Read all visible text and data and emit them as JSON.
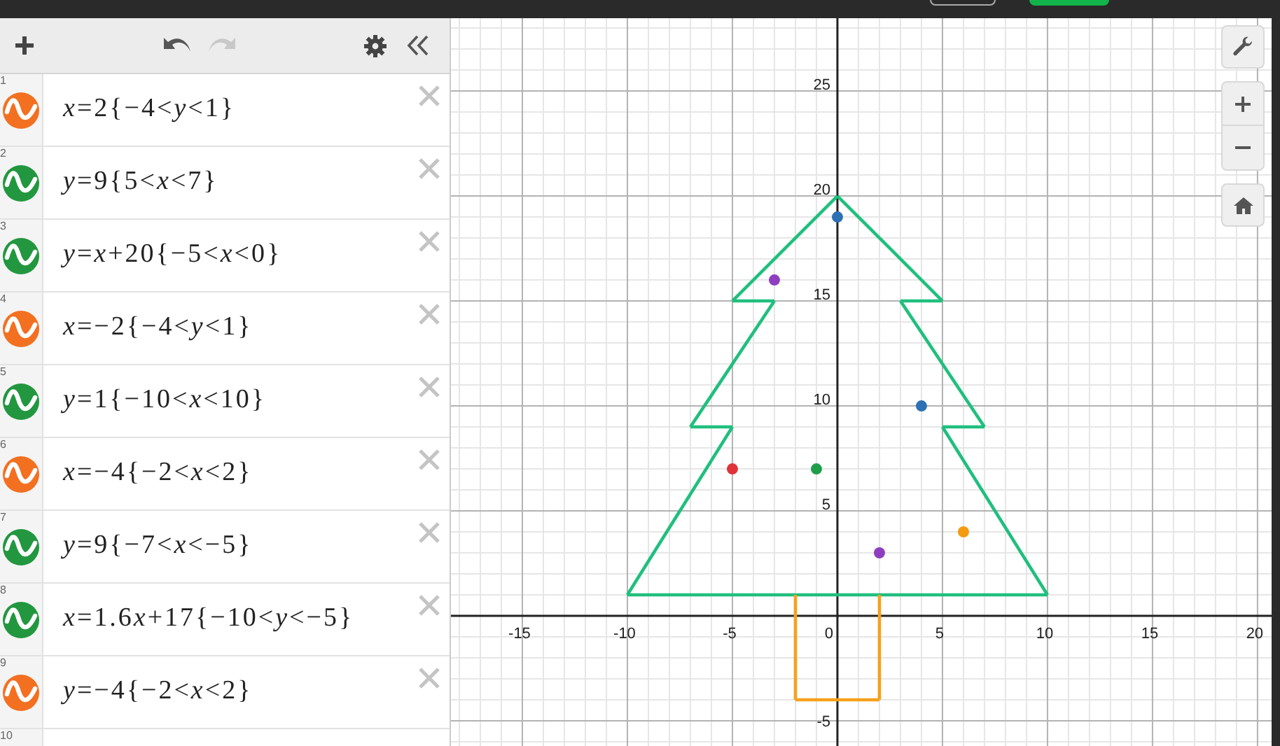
{
  "expressions": [
    {
      "number": "1",
      "color": "#f37021",
      "latex": [
        "*x*=2{−4<*y*<1}"
      ]
    },
    {
      "number": "2",
      "color": "#22973f",
      "latex": [
        "*y*=9{5<*x*<7}"
      ]
    },
    {
      "number": "3",
      "color": "#22973f",
      "latex": [
        "*y*=*x*+20{−5<*x*<0}"
      ]
    },
    {
      "number": "4",
      "color": "#f37021",
      "latex": [
        "*x*=−2{−4<*y*<1}"
      ]
    },
    {
      "number": "5",
      "color": "#22973f",
      "latex": [
        "*y*=1{−10<*x*<10}"
      ]
    },
    {
      "number": "6",
      "color": "#f37021",
      "latex": [
        "*x*=−4{−2<*x*<2}"
      ]
    },
    {
      "number": "7",
      "color": "#22973f",
      "latex": [
        "*y*=9{−7<*x*<−5}"
      ]
    },
    {
      "number": "8",
      "color": "#22973f",
      "latex": [
        "*x*=1.6",
        "*x*+17{−10<*y*<−5}"
      ]
    },
    {
      "number": "9",
      "color": "#f37021",
      "latex": [
        "*y*=−4{−2<*x*<2}"
      ]
    }
  ],
  "partial_row": {
    "number": "10"
  },
  "graph": {
    "chart_data": {
      "type": "line",
      "grid": true,
      "xlim": [
        -18.4,
        20.67
      ],
      "ylim": [
        -6.2,
        28.47
      ],
      "xticks": [
        -15,
        -10,
        -5,
        0,
        5,
        10,
        15,
        20
      ],
      "yticks": [
        -5,
        5,
        10,
        15,
        20,
        25
      ],
      "series": [
        {
          "type": "line",
          "color": "#20bf7e",
          "x": [
            -5,
            0
          ],
          "values": [
            15,
            20
          ]
        },
        {
          "type": "line",
          "color": "#20bf7e",
          "x": [
            -5,
            -3
          ],
          "values": [
            15,
            15
          ]
        },
        {
          "type": "line",
          "color": "#20bf7e",
          "x": [
            -7,
            -3
          ],
          "values": [
            9,
            15
          ]
        },
        {
          "type": "line",
          "color": "#20bf7e",
          "x": [
            -7,
            -5
          ],
          "values": [
            9,
            9
          ]
        },
        {
          "type": "line",
          "color": "#20bf7e",
          "x": [
            -10,
            -5
          ],
          "values": [
            1,
            9
          ]
        },
        {
          "type": "line",
          "color": "#20bf7e",
          "x": [
            -10,
            10
          ],
          "values": [
            1,
            1
          ]
        },
        {
          "type": "line",
          "color": "#20bf7e",
          "x": [
            5,
            10
          ],
          "values": [
            9,
            1
          ]
        },
        {
          "type": "line",
          "color": "#20bf7e",
          "x": [
            5,
            7
          ],
          "values": [
            9,
            9
          ]
        },
        {
          "type": "line",
          "color": "#20bf7e",
          "x": [
            3,
            7
          ],
          "values": [
            15,
            9
          ]
        },
        {
          "type": "line",
          "color": "#20bf7e",
          "x": [
            3,
            5
          ],
          "values": [
            15,
            15
          ]
        },
        {
          "type": "line",
          "color": "#20bf7e",
          "x": [
            0,
            5
          ],
          "values": [
            20,
            15
          ]
        },
        {
          "type": "line",
          "color": "#f5a11d",
          "x": [
            -2,
            -2
          ],
          "values": [
            1,
            -4
          ]
        },
        {
          "type": "line",
          "color": "#f5a11d",
          "x": [
            -2,
            2
          ],
          "values": [
            -4,
            -4
          ]
        },
        {
          "type": "line",
          "color": "#f5a11d",
          "x": [
            2,
            2
          ],
          "values": [
            -4,
            1
          ]
        },
        {
          "type": "scatter",
          "color": "#2d70b3",
          "x": [
            0,
            4
          ],
          "values": [
            19,
            10
          ]
        },
        {
          "type": "scatter",
          "color": "#8e3fbf",
          "x": [
            -3,
            2
          ],
          "values": [
            16,
            3
          ]
        },
        {
          "type": "scatter",
          "color": "#e0323a",
          "x": [
            -5
          ],
          "values": [
            7
          ]
        },
        {
          "type": "scatter",
          "color": "#1e9e4a",
          "x": [
            -1
          ],
          "values": [
            7
          ]
        },
        {
          "type": "scatter",
          "color": "#f39c12",
          "x": [
            6
          ],
          "values": [
            4
          ]
        }
      ]
    }
  }
}
